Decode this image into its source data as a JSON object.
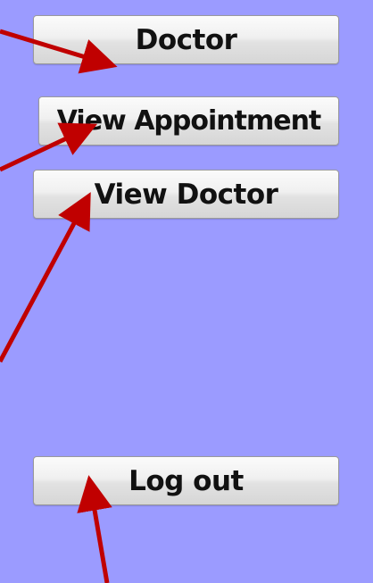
{
  "sidebar": {
    "background_color": "#9b9bff",
    "buttons": [
      {
        "label": "Doctor"
      },
      {
        "label": "View Appointment"
      },
      {
        "label": "View Doctor"
      },
      {
        "label": "Log out"
      }
    ]
  },
  "annotation": {
    "arrow_color": "#c00000"
  }
}
